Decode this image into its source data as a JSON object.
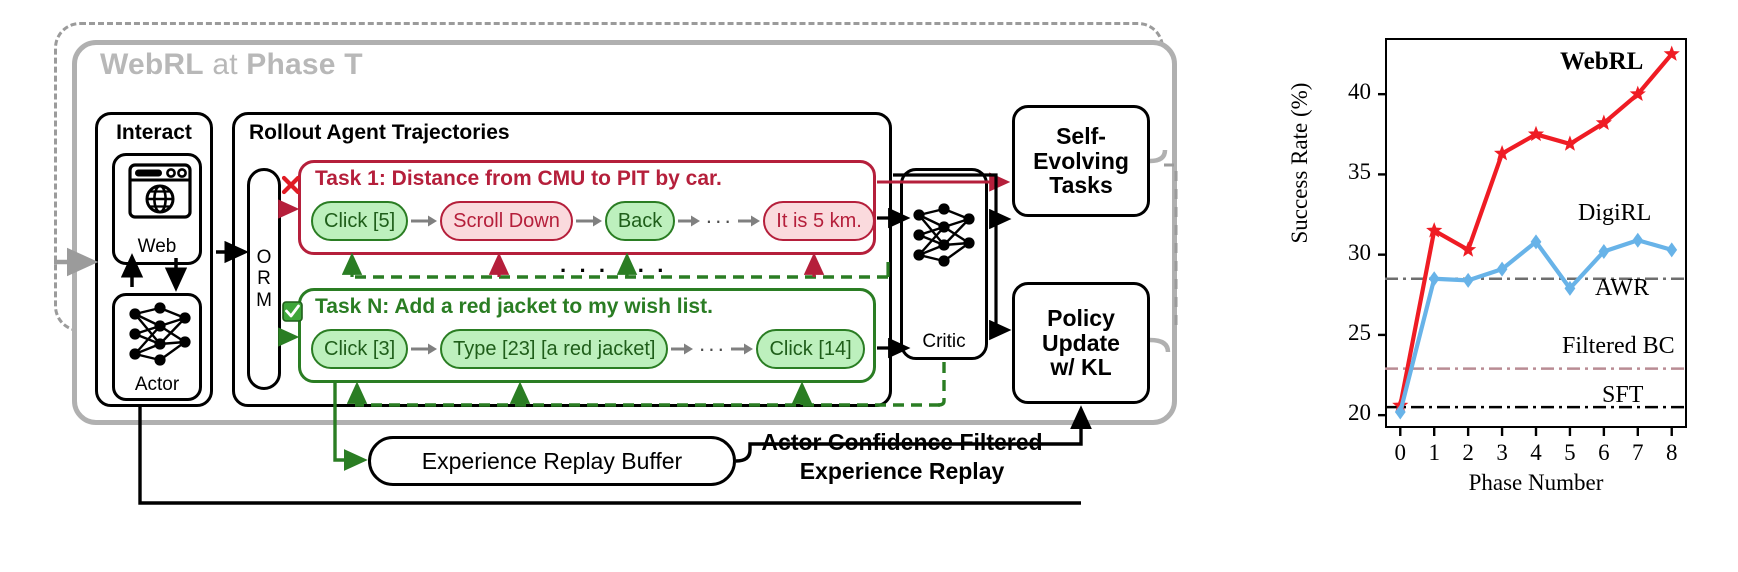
{
  "diagram": {
    "title_bold": "WebRL",
    "title_light": " at ",
    "title_bold2": "Phase T",
    "interact": {
      "header": "Interact",
      "web_label": "Web",
      "web_icon": "browser-globe-icon",
      "actor_label": "Actor",
      "actor_icon": "neural-network-icon"
    },
    "rollout": {
      "header": "Rollout Agent Trajectories",
      "orm_label": "ORM",
      "orm_letters": [
        "O",
        "R",
        "M"
      ],
      "ellipsis": "· · · · · ·",
      "task1": {
        "heading": "Task 1: Distance from CMU to PIT by car.",
        "status_icon": "cross-mark-icon",
        "steps": [
          {
            "label": "Click [5]",
            "style": "green"
          },
          {
            "label": "Scroll Down",
            "style": "pink"
          },
          {
            "label": "Back",
            "style": "green"
          },
          {
            "label": "It is 5 km.",
            "style": "pink"
          }
        ]
      },
      "taskn": {
        "heading": "Task N: Add a red jacket to my wish list.",
        "status_icon": "check-mark-icon",
        "steps": [
          {
            "label": "Click [3]",
            "style": "green"
          },
          {
            "label": "Type [23] [a red jacket]",
            "style": "green"
          },
          {
            "label": "Click [14]",
            "style": "green"
          }
        ]
      }
    },
    "critic": {
      "label": "Critic",
      "icon": "neural-network-icon"
    },
    "self_evolving": {
      "lines": [
        "Self-",
        "Evolving",
        "Tasks"
      ]
    },
    "policy_update": {
      "lines": [
        "Policy",
        "Update",
        "w/ KL"
      ]
    },
    "replay_buffer": {
      "label": "Experience Replay Buffer"
    },
    "annotation": {
      "line1": "Actor Confidence Filtered",
      "line2": "Experience Replay"
    },
    "colors": {
      "red": "#b51f3b",
      "green": "#2a7d23",
      "grey": "#b0b0b0",
      "pink_fill": "#fadadd",
      "green_fill": "#bdf0bd"
    }
  },
  "chart_data": {
    "type": "line",
    "title": "",
    "xlabel": "Phase Number",
    "ylabel": "Success Rate (%)",
    "x": [
      0,
      1,
      2,
      3,
      4,
      5,
      6,
      7,
      8
    ],
    "xticks": [
      "0",
      "1",
      "2",
      "3",
      "4",
      "5",
      "6",
      "7",
      "8"
    ],
    "yticks": [
      "20",
      "25",
      "30",
      "35",
      "40"
    ],
    "ylim": [
      19.2,
      43.5
    ],
    "xlim": [
      -0.45,
      8.45
    ],
    "grid": false,
    "legend": "inline-annotations",
    "series": [
      {
        "name": "WebRL",
        "color": "#ef1c24",
        "marker": "star",
        "values": [
          20.6,
          31.5,
          30.3,
          36.3,
          37.5,
          36.9,
          38.2,
          40.0,
          42.5
        ]
      },
      {
        "name": "DigiRL",
        "color": "#68b3e8",
        "marker": "diamond",
        "values": [
          20.2,
          28.5,
          28.4,
          29.1,
          30.8,
          27.9,
          30.2,
          30.9,
          30.3
        ]
      }
    ],
    "hlines": [
      {
        "name": "AWR",
        "value": 28.5,
        "color": "#6e6e6e",
        "style": "dashdot"
      },
      {
        "name": "Filtered BC",
        "value": 22.9,
        "color": "#b98c94",
        "style": "dashdot"
      },
      {
        "name": "SFT",
        "value": 20.5,
        "color": "#000000",
        "style": "dashdot"
      }
    ],
    "annotations": [
      {
        "text": "WebRL",
        "bold": true
      },
      {
        "text": "DigiRL",
        "bold": false
      },
      {
        "text": "AWR",
        "bold": false
      },
      {
        "text": "Filtered BC",
        "bold": false
      },
      {
        "text": "SFT",
        "bold": false
      }
    ]
  }
}
